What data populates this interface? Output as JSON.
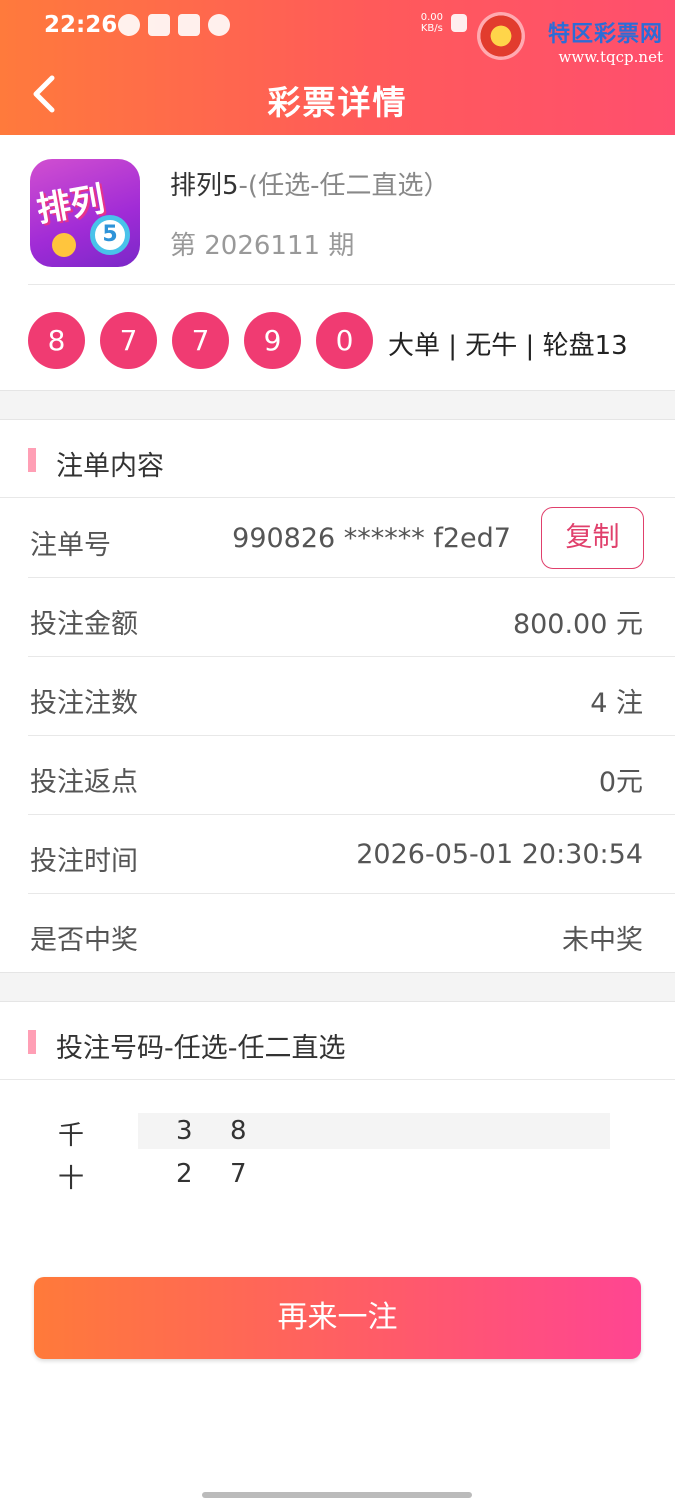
{
  "status_bar": {
    "time": "22:26",
    "net_speed_value": "0.00",
    "net_speed_unit": "KB/s"
  },
  "watermark": {
    "title": "特区彩票网",
    "url": "www.tqcp.net"
  },
  "header": {
    "title": "彩票详情",
    "back_icon": "chevron-left-icon"
  },
  "lottery": {
    "name": "排列5",
    "play": "-(任选-任二直选）",
    "issue": "第 2026111 期",
    "logo_text": "排列",
    "logo_ball": "5",
    "draw_numbers": [
      "8",
      "7",
      "7",
      "9",
      "0"
    ],
    "result_tags": "大单 | 无牛 | 轮盘13"
  },
  "bet_section": {
    "title": "注单内容",
    "rows": [
      {
        "label": "注单号",
        "value": "990826 ****** f2ed7"
      },
      {
        "label": "投注金额",
        "value": "800.00 元"
      },
      {
        "label": "投注注数",
        "value": "4 注"
      },
      {
        "label": "投注返点",
        "value": "0元"
      },
      {
        "label": "投注时间",
        "value": "2026-05-01 20:30:54"
      },
      {
        "label": "是否中奖",
        "value": "未中奖"
      }
    ],
    "copy_label": "复制"
  },
  "numbers_section": {
    "title": "投注号码-任选-任二直选",
    "rows": [
      {
        "position": "千",
        "digits": [
          "3",
          "8"
        ]
      },
      {
        "position": "十",
        "digits": [
          "2",
          "7"
        ]
      }
    ]
  },
  "actions": {
    "again_label": "再来一注"
  },
  "colors": {
    "header_gradient_start": "#ff7a3c",
    "header_gradient_end": "#ff4f6e",
    "ball": "#f03b72",
    "accent": "#e0406c",
    "section_bar": "#ff9fb5"
  }
}
